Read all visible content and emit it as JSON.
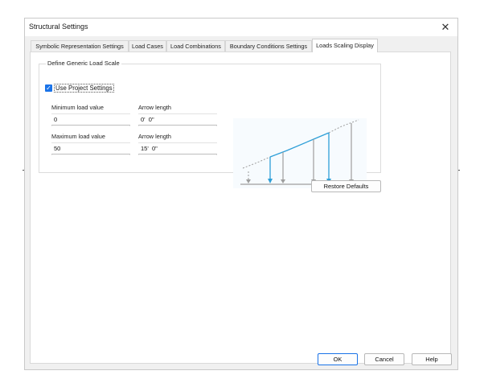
{
  "window": {
    "title": "Structural Settings"
  },
  "tabs": [
    {
      "label": "Symbolic Representation Settings",
      "active": false
    },
    {
      "label": "Load Cases",
      "active": false
    },
    {
      "label": "Load Combinations",
      "active": false
    },
    {
      "label": "Boundary Conditions Settings",
      "active": false
    },
    {
      "label": "Loads Scaling Display",
      "active": true
    }
  ],
  "group": {
    "title": "Define Generic Load Scale",
    "use_project_settings": {
      "label": "Use Project Settings",
      "checked": true
    },
    "min_load": {
      "label": "Minimum load value",
      "value": "0"
    },
    "min_arrow": {
      "label": "Arrow length",
      "value": "0'  0\""
    },
    "max_load": {
      "label": "Maximum load value",
      "value": "50"
    },
    "max_arrow": {
      "label": "Arrow length",
      "value": "15'  0\""
    }
  },
  "buttons": {
    "restore_defaults": "Restore Defaults",
    "ok": "OK",
    "cancel": "Cancel",
    "help": "Help"
  },
  "icons": {
    "close": "close-icon",
    "check": "checkmark-icon"
  },
  "colors": {
    "accent": "#1a73e8",
    "preview_blue": "#2e9fd8",
    "preview_gray": "#9e9e9e"
  }
}
